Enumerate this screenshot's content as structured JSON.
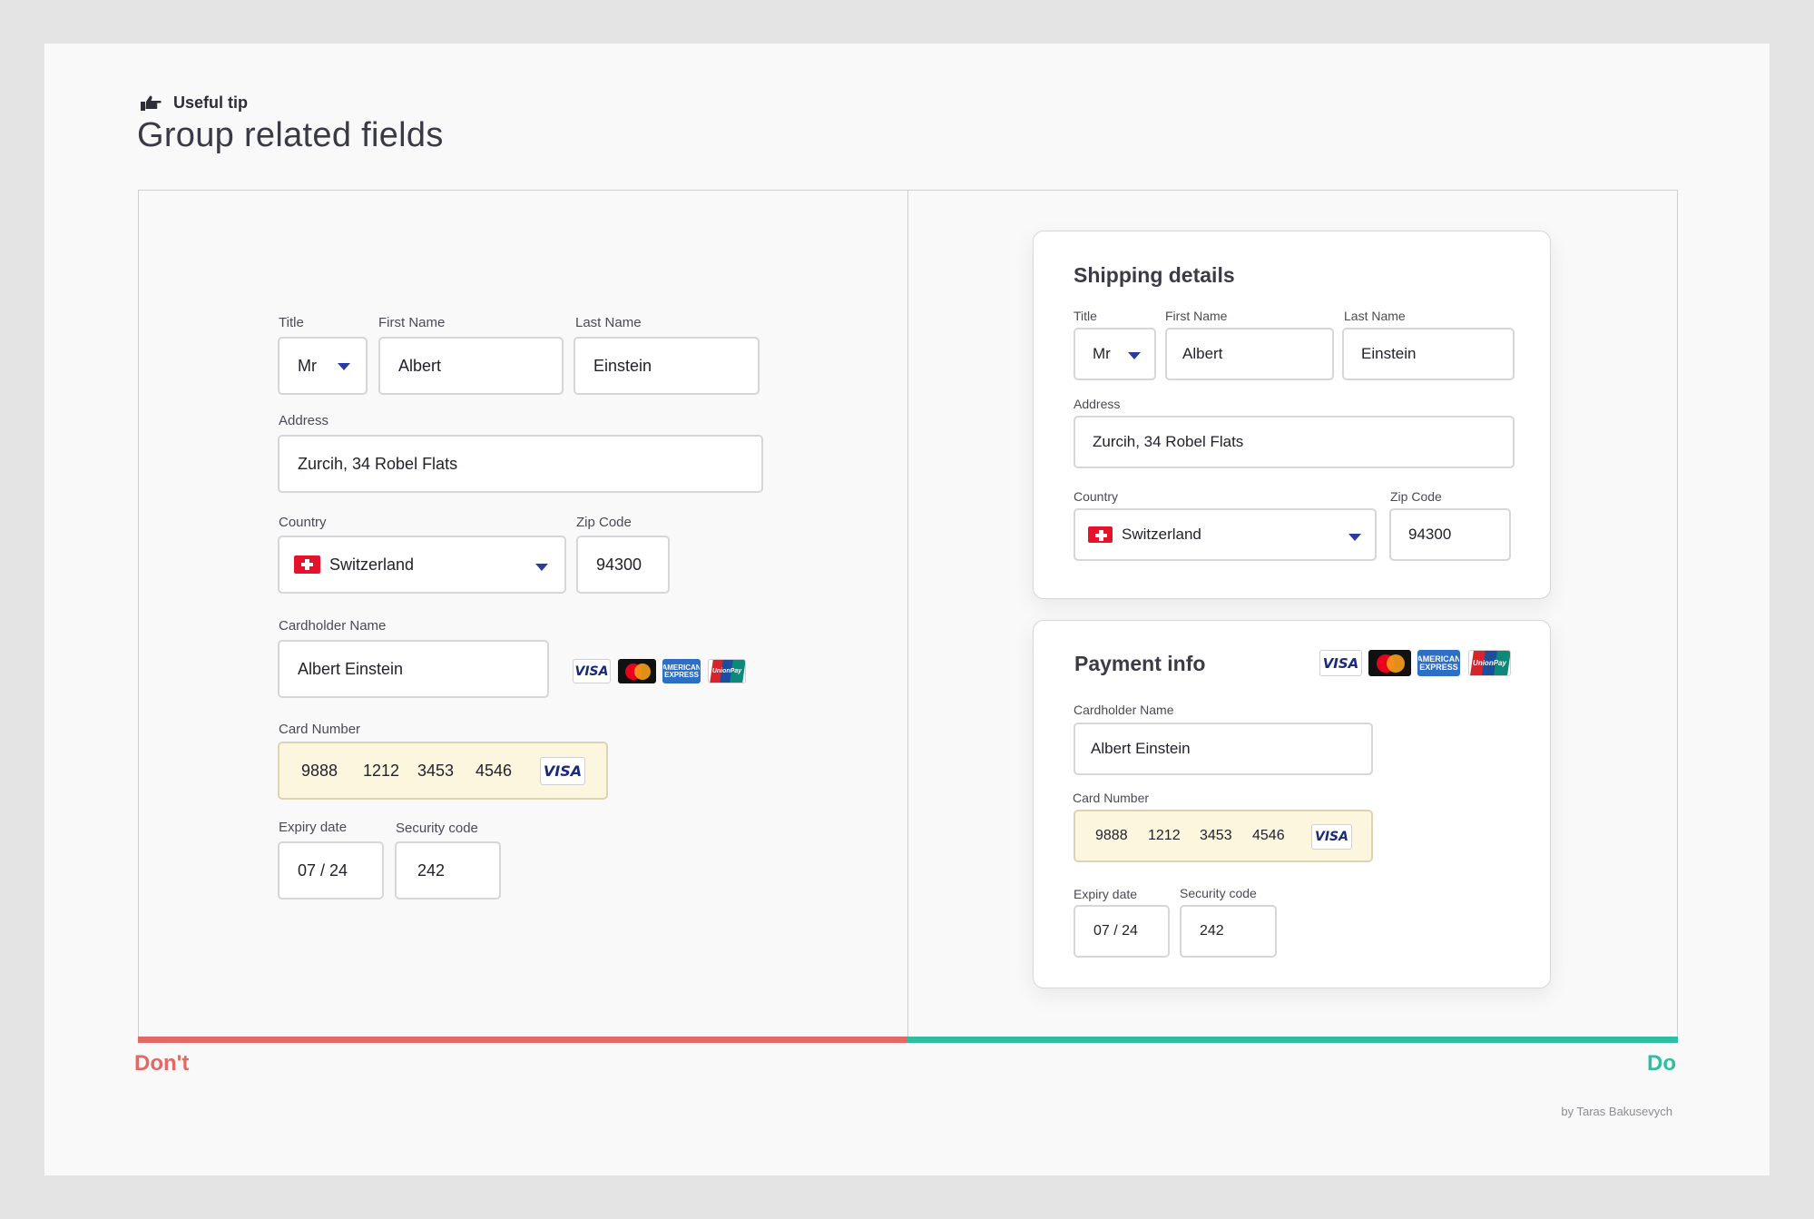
{
  "tip": {
    "label": "Useful tip",
    "icon": "pointing-hand-icon"
  },
  "heading": "Group related fields",
  "fields": {
    "title_label": "Title",
    "title_value": "Mr",
    "first_name_label": "First Name",
    "first_name_value": "Albert",
    "last_name_label": "Last Name",
    "last_name_value": "Einstein",
    "address_label": "Address",
    "address_value": "Zurcih, 34 Robel Flats",
    "country_label": "Country",
    "country_value": "Switzerland",
    "zip_label": "Zip Code",
    "zip_value": "94300",
    "cardholder_label": "Cardholder Name",
    "cardholder_value": "Albert Einstein",
    "card_number_label": "Card Number",
    "card_number_groups": [
      "9888",
      "1212",
      "3453",
      "4546"
    ],
    "expiry_label": "Expiry date",
    "expiry_value": "07 / 24",
    "security_label": "Security code",
    "security_value": "242"
  },
  "logos": {
    "visa": "VISA",
    "amex_line1": "AMERICAN",
    "amex_line2": "EXPRESS",
    "unionpay": "UnionPay"
  },
  "right_card_titles": {
    "shipping": "Shipping details",
    "payment": "Payment info"
  },
  "verdict": {
    "dont": "Don't",
    "do": "Do"
  },
  "credit": "by Taras Bakusevych",
  "colors": {
    "dont": "#e36a64",
    "do": "#2ebfa0",
    "highlight": "#fdf6df",
    "caret": "#2b3d9c"
  }
}
